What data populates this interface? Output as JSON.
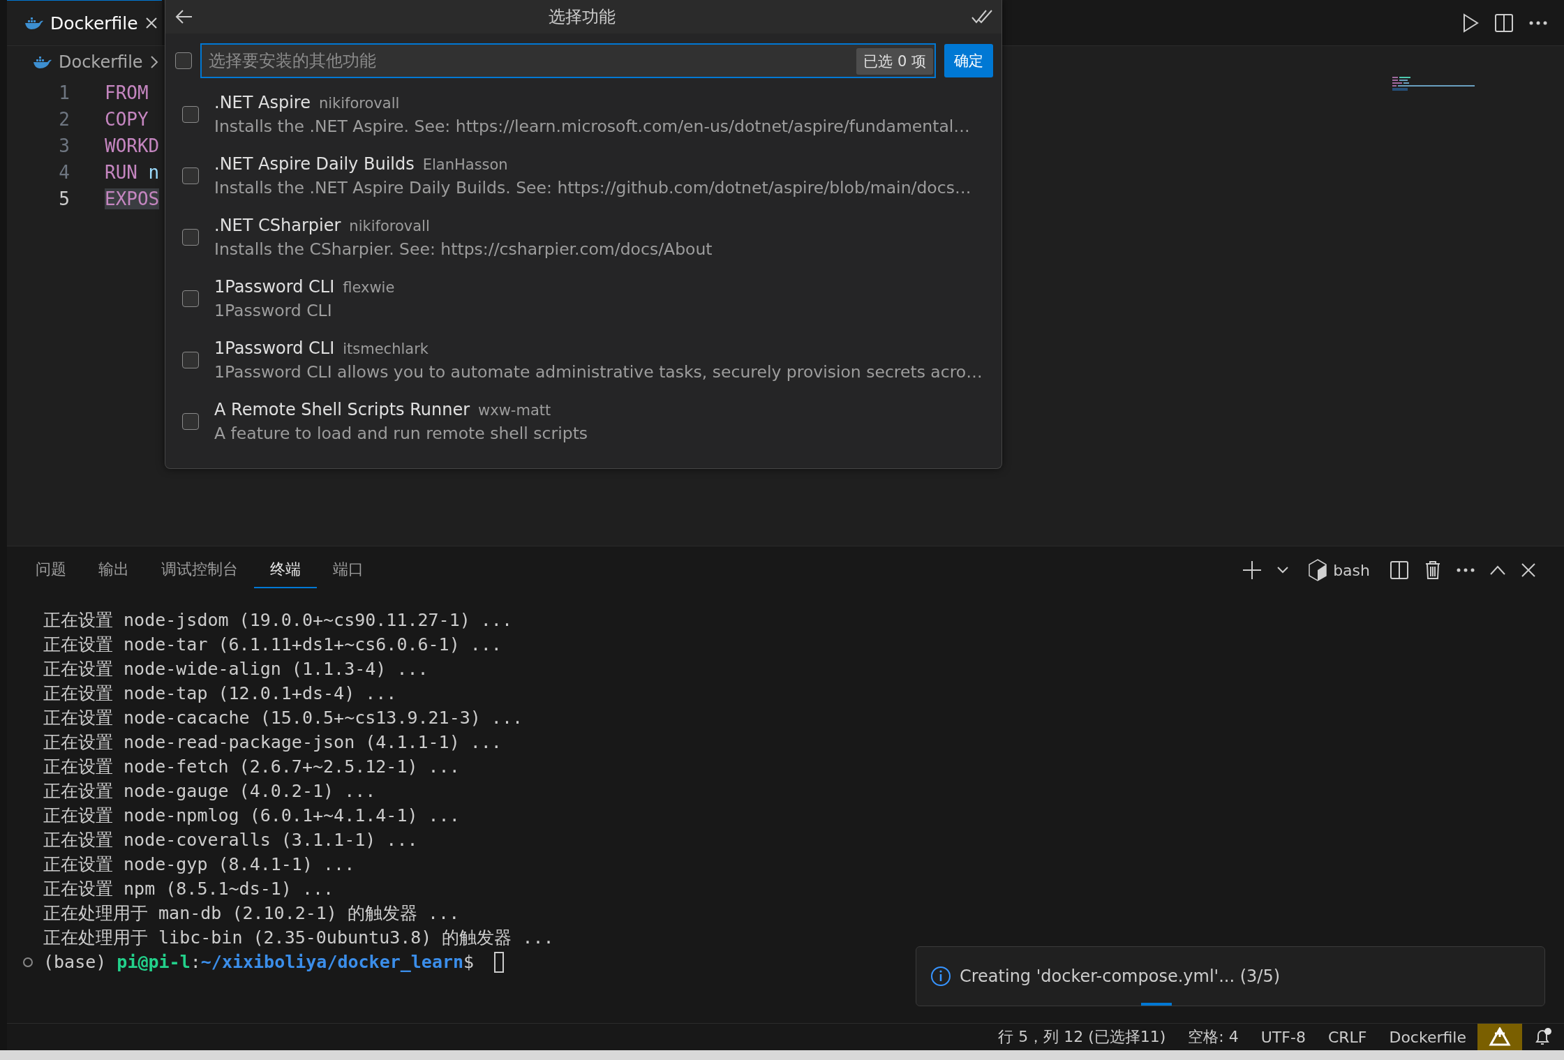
{
  "editor_tab": {
    "label": "Dockerfile",
    "selected": true
  },
  "breadcrumb": "Dockerfile",
  "code_lines": [
    {
      "number": "1",
      "selected": false,
      "tokens": [
        {
          "text": "FROM",
          "kind": "keyword"
        }
      ]
    },
    {
      "number": "2",
      "selected": false,
      "tokens": [
        {
          "text": "COPY",
          "kind": "keyword"
        }
      ]
    },
    {
      "number": "3",
      "selected": false,
      "tokens": [
        {
          "text": "WORKD",
          "kind": "keyword"
        }
      ]
    },
    {
      "number": "4",
      "selected": false,
      "tokens": [
        {
          "text": "RUN",
          "kind": "keyword"
        },
        {
          "text": " n",
          "kind": "plain"
        }
      ]
    },
    {
      "number": "5",
      "selected": true,
      "tokens": [
        {
          "text": "EXPOS",
          "kind": "keyword"
        }
      ]
    }
  ],
  "quick_pick": {
    "title": "选择功能",
    "all_checked": false,
    "placeholder": "选择要安装的其他功能",
    "count_badge": "已选 0 项",
    "ok_button": "确定",
    "items": [
      {
        "label": ".NET Aspire",
        "author": "nikiforovall",
        "description": "Installs the .NET Aspire. See: https://learn.microsoft.com/en-us/dotnet/aspire/fundamental…",
        "checked": false
      },
      {
        "label": ".NET Aspire Daily Builds",
        "author": "ElanHasson",
        "description": "Installs the .NET Aspire Daily Builds. See: https://github.com/dotnet/aspire/blob/main/docs…",
        "checked": false
      },
      {
        "label": ".NET CSharpier",
        "author": "nikiforovall",
        "description": "Installs the CSharpier. See: https://csharpier.com/docs/About",
        "checked": false
      },
      {
        "label": "1Password CLI",
        "author": "flexwie",
        "description": "1Password CLI",
        "checked": false
      },
      {
        "label": "1Password CLI",
        "author": "itsmechlark",
        "description": "1Password CLI allows you to automate administrative tasks, securely provision secrets acro…",
        "checked": false
      },
      {
        "label": "A Remote Shell Scripts Runner",
        "author": "wxw-matt",
        "description": "A feature to load and run remote shell scripts",
        "checked": false
      }
    ]
  },
  "panel": {
    "tabs": [
      {
        "label": "问题",
        "selected": false
      },
      {
        "label": "输出",
        "selected": false
      },
      {
        "label": "调试控制台",
        "selected": false
      },
      {
        "label": "终端",
        "selected": true
      },
      {
        "label": "端口",
        "selected": false
      }
    ],
    "shell": "bash",
    "terminal_lines": [
      "正在设置 node-jsdom (19.0.0+~cs90.11.27-1) ...",
      "正在设置 node-tar (6.1.11+ds1+~cs6.0.6-1) ...",
      "正在设置 node-wide-align (1.1.3-4) ...",
      "正在设置 node-tap (12.0.1+ds-4) ...",
      "正在设置 node-cacache (15.0.5+~cs13.9.21-3) ...",
      "正在设置 node-read-package-json (4.1.1-1) ...",
      "正在设置 node-fetch (2.6.7+~2.5.12-1) ...",
      "正在设置 node-gauge (4.0.2-1) ...",
      "正在设置 node-npmlog (6.0.1+~4.1.4-1) ...",
      "正在设置 node-coveralls (3.1.1-1) ...",
      "正在设置 node-gyp (8.4.1-1) ...",
      "正在设置 npm (8.5.1~ds-1) ...",
      "正在处理用于 man-db (2.10.2-1) 的触发器 ...",
      "正在处理用于 libc-bin (2.35-0ubuntu3.8) 的触发器 ..."
    ],
    "prompt": [
      {
        "text": "(base) ",
        "kind": "plain"
      },
      {
        "text": "pi@pi-l",
        "kind": "user"
      },
      {
        "text": ":",
        "kind": "plain"
      },
      {
        "text": "~/xixiboliya/docker_learn",
        "kind": "path"
      },
      {
        "text": "$ ",
        "kind": "plain"
      }
    ]
  },
  "notification": {
    "message": "Creating 'docker-compose.yml'... (3/5)"
  },
  "status_bar": {
    "items": [
      "行 5，列 12 (已选择11)",
      "空格: 4",
      "UTF-8",
      "CRLF",
      "Dockerfile"
    ],
    "unread_notifications": true
  }
}
